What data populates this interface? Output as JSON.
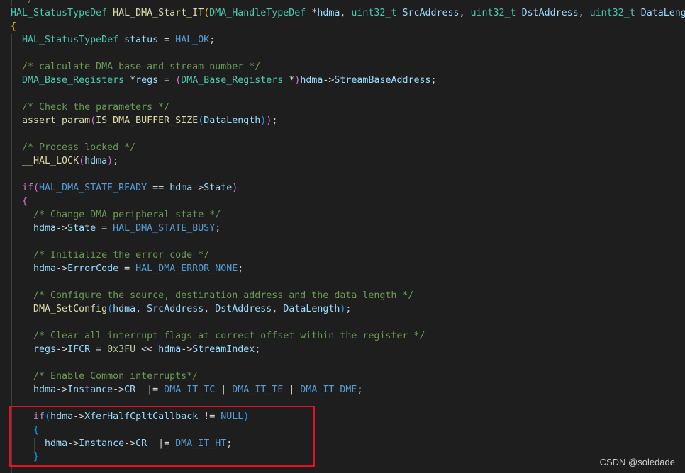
{
  "editor": {
    "theme_colors": {
      "background": "#1e1e1e",
      "type": "#4ec9b0",
      "function": "#dcdcaa",
      "param": "#9cdcfe",
      "macro": "#569cd6",
      "keyword": "#c586c0",
      "comment": "#6a9955",
      "number": "#b5cea8",
      "bracket_gold": "#ffd700",
      "bracket_purple": "#da70d6",
      "bracket_blue": "#179fff",
      "highlight_border": "#e81123"
    },
    "lines": [
      [
        {
          "t": "  */",
          "c": "comment"
        }
      ],
      [
        {
          "t": "HAL_StatusTypeDef",
          "c": "type"
        },
        {
          "t": " ",
          "c": "op"
        },
        {
          "t": "HAL_DMA_Start_IT",
          "c": "fn"
        },
        {
          "t": "(",
          "c": "paren1"
        },
        {
          "t": "DMA_HandleTypeDef",
          "c": "type"
        },
        {
          "t": " *",
          "c": "op"
        },
        {
          "t": "hdma",
          "c": "param"
        },
        {
          "t": ", ",
          "c": "op"
        },
        {
          "t": "uint32_t",
          "c": "type"
        },
        {
          "t": " ",
          "c": "op"
        },
        {
          "t": "SrcAddress",
          "c": "param"
        },
        {
          "t": ", ",
          "c": "op"
        },
        {
          "t": "uint32_t",
          "c": "type"
        },
        {
          "t": " ",
          "c": "op"
        },
        {
          "t": "DstAddress",
          "c": "param"
        },
        {
          "t": ", ",
          "c": "op"
        },
        {
          "t": "uint32_t",
          "c": "type"
        },
        {
          "t": " ",
          "c": "op"
        },
        {
          "t": "DataLength",
          "c": "param"
        },
        {
          "t": ")",
          "c": "paren1"
        }
      ],
      [
        {
          "t": "{",
          "c": "paren1"
        }
      ],
      [
        {
          "t": "  ",
          "c": "op"
        },
        {
          "t": "HAL_StatusTypeDef",
          "c": "type"
        },
        {
          "t": " ",
          "c": "op"
        },
        {
          "t": "status",
          "c": "param"
        },
        {
          "t": " = ",
          "c": "op"
        },
        {
          "t": "HAL_OK",
          "c": "macro"
        },
        {
          "t": ";",
          "c": "op"
        }
      ],
      [],
      [
        {
          "t": "  ",
          "c": "op"
        },
        {
          "t": "/* calculate DMA base and stream number */",
          "c": "comment"
        }
      ],
      [
        {
          "t": "  ",
          "c": "op"
        },
        {
          "t": "DMA_Base_Registers",
          "c": "type"
        },
        {
          "t": " *",
          "c": "op"
        },
        {
          "t": "regs",
          "c": "param"
        },
        {
          "t": " = ",
          "c": "op"
        },
        {
          "t": "(",
          "c": "paren2"
        },
        {
          "t": "DMA_Base_Registers",
          "c": "type"
        },
        {
          "t": " *",
          "c": "op"
        },
        {
          "t": ")",
          "c": "paren2"
        },
        {
          "t": "hdma",
          "c": "param"
        },
        {
          "t": "->",
          "c": "op"
        },
        {
          "t": "StreamBaseAddress",
          "c": "param"
        },
        {
          "t": ";",
          "c": "op"
        }
      ],
      [],
      [
        {
          "t": "  ",
          "c": "op"
        },
        {
          "t": "/* Check the parameters */",
          "c": "comment"
        }
      ],
      [
        {
          "t": "  ",
          "c": "op"
        },
        {
          "t": "assert_param",
          "c": "fn"
        },
        {
          "t": "(",
          "c": "paren2"
        },
        {
          "t": "IS_DMA_BUFFER_SIZE",
          "c": "fn"
        },
        {
          "t": "(",
          "c": "paren3"
        },
        {
          "t": "DataLength",
          "c": "param"
        },
        {
          "t": ")",
          "c": "paren3"
        },
        {
          "t": ")",
          "c": "paren2"
        },
        {
          "t": ";",
          "c": "op"
        }
      ],
      [],
      [
        {
          "t": "  ",
          "c": "op"
        },
        {
          "t": "/* Process locked */",
          "c": "comment"
        }
      ],
      [
        {
          "t": "  ",
          "c": "op"
        },
        {
          "t": "__HAL_LOCK",
          "c": "fn"
        },
        {
          "t": "(",
          "c": "paren2"
        },
        {
          "t": "hdma",
          "c": "param"
        },
        {
          "t": ")",
          "c": "paren2"
        },
        {
          "t": ";",
          "c": "op"
        }
      ],
      [],
      [
        {
          "t": "  ",
          "c": "op"
        },
        {
          "t": "if",
          "c": "kw"
        },
        {
          "t": "(",
          "c": "paren2"
        },
        {
          "t": "HAL_DMA_STATE_READY",
          "c": "macro"
        },
        {
          "t": " == ",
          "c": "op"
        },
        {
          "t": "hdma",
          "c": "param"
        },
        {
          "t": "->",
          "c": "op"
        },
        {
          "t": "State",
          "c": "param"
        },
        {
          "t": ")",
          "c": "paren2"
        }
      ],
      [
        {
          "t": "  ",
          "c": "op"
        },
        {
          "t": "{",
          "c": "paren2"
        }
      ],
      [
        {
          "t": "    ",
          "c": "op"
        },
        {
          "t": "/* Change DMA peripheral state */",
          "c": "comment"
        }
      ],
      [
        {
          "t": "    ",
          "c": "op"
        },
        {
          "t": "hdma",
          "c": "param"
        },
        {
          "t": "->",
          "c": "op"
        },
        {
          "t": "State",
          "c": "param"
        },
        {
          "t": " = ",
          "c": "op"
        },
        {
          "t": "HAL_DMA_STATE_BUSY",
          "c": "macro"
        },
        {
          "t": ";",
          "c": "op"
        }
      ],
      [],
      [
        {
          "t": "    ",
          "c": "op"
        },
        {
          "t": "/* Initialize the error code */",
          "c": "comment"
        }
      ],
      [
        {
          "t": "    ",
          "c": "op"
        },
        {
          "t": "hdma",
          "c": "param"
        },
        {
          "t": "->",
          "c": "op"
        },
        {
          "t": "ErrorCode",
          "c": "param"
        },
        {
          "t": " = ",
          "c": "op"
        },
        {
          "t": "HAL_DMA_ERROR_NONE",
          "c": "macro"
        },
        {
          "t": ";",
          "c": "op"
        }
      ],
      [],
      [
        {
          "t": "    ",
          "c": "op"
        },
        {
          "t": "/* Configure the source, destination address and the data length */",
          "c": "comment"
        }
      ],
      [
        {
          "t": "    ",
          "c": "op"
        },
        {
          "t": "DMA_SetConfig",
          "c": "fn"
        },
        {
          "t": "(",
          "c": "paren3"
        },
        {
          "t": "hdma",
          "c": "param"
        },
        {
          "t": ", ",
          "c": "op"
        },
        {
          "t": "SrcAddress",
          "c": "param"
        },
        {
          "t": ", ",
          "c": "op"
        },
        {
          "t": "DstAddress",
          "c": "param"
        },
        {
          "t": ", ",
          "c": "op"
        },
        {
          "t": "DataLength",
          "c": "param"
        },
        {
          "t": ")",
          "c": "paren3"
        },
        {
          "t": ";",
          "c": "op"
        }
      ],
      [],
      [
        {
          "t": "    ",
          "c": "op"
        },
        {
          "t": "/* Clear all interrupt flags at correct offset within the register */",
          "c": "comment"
        }
      ],
      [
        {
          "t": "    ",
          "c": "op"
        },
        {
          "t": "regs",
          "c": "param"
        },
        {
          "t": "->",
          "c": "op"
        },
        {
          "t": "IFCR",
          "c": "param"
        },
        {
          "t": " = ",
          "c": "op"
        },
        {
          "t": "0x3FU",
          "c": "num"
        },
        {
          "t": " << ",
          "c": "op"
        },
        {
          "t": "hdma",
          "c": "param"
        },
        {
          "t": "->",
          "c": "op"
        },
        {
          "t": "StreamIndex",
          "c": "param"
        },
        {
          "t": ";",
          "c": "op"
        }
      ],
      [],
      [
        {
          "t": "    ",
          "c": "op"
        },
        {
          "t": "/* Enable Common interrupts*/",
          "c": "comment"
        }
      ],
      [
        {
          "t": "    ",
          "c": "op"
        },
        {
          "t": "hdma",
          "c": "param"
        },
        {
          "t": "->",
          "c": "op"
        },
        {
          "t": "Instance",
          "c": "param"
        },
        {
          "t": "->",
          "c": "op"
        },
        {
          "t": "CR",
          "c": "param"
        },
        {
          "t": "  |= ",
          "c": "op"
        },
        {
          "t": "DMA_IT_TC",
          "c": "macro"
        },
        {
          "t": " | ",
          "c": "op"
        },
        {
          "t": "DMA_IT_TE",
          "c": "macro"
        },
        {
          "t": " | ",
          "c": "op"
        },
        {
          "t": "DMA_IT_DME",
          "c": "macro"
        },
        {
          "t": ";",
          "c": "op"
        }
      ],
      [],
      [
        {
          "t": "    ",
          "c": "op"
        },
        {
          "t": "if",
          "c": "kw"
        },
        {
          "t": "(",
          "c": "paren3"
        },
        {
          "t": "hdma",
          "c": "param"
        },
        {
          "t": "->",
          "c": "op"
        },
        {
          "t": "XferHalfCpltCallback",
          "c": "param"
        },
        {
          "t": " != ",
          "c": "op"
        },
        {
          "t": "NULL",
          "c": "macro"
        },
        {
          "t": ")",
          "c": "paren3"
        }
      ],
      [
        {
          "t": "    ",
          "c": "op"
        },
        {
          "t": "{",
          "c": "paren3"
        }
      ],
      [
        {
          "t": "      ",
          "c": "op"
        },
        {
          "t": "hdma",
          "c": "param"
        },
        {
          "t": "->",
          "c": "op"
        },
        {
          "t": "Instance",
          "c": "param"
        },
        {
          "t": "->",
          "c": "op"
        },
        {
          "t": "CR",
          "c": "param"
        },
        {
          "t": "  |= ",
          "c": "op"
        },
        {
          "t": "DMA_IT_HT",
          "c": "macro"
        },
        {
          "t": ";",
          "c": "op"
        }
      ],
      [
        {
          "t": "    ",
          "c": "op"
        },
        {
          "t": "}",
          "c": "paren3"
        }
      ]
    ]
  },
  "watermark": "CSDN @soledade"
}
